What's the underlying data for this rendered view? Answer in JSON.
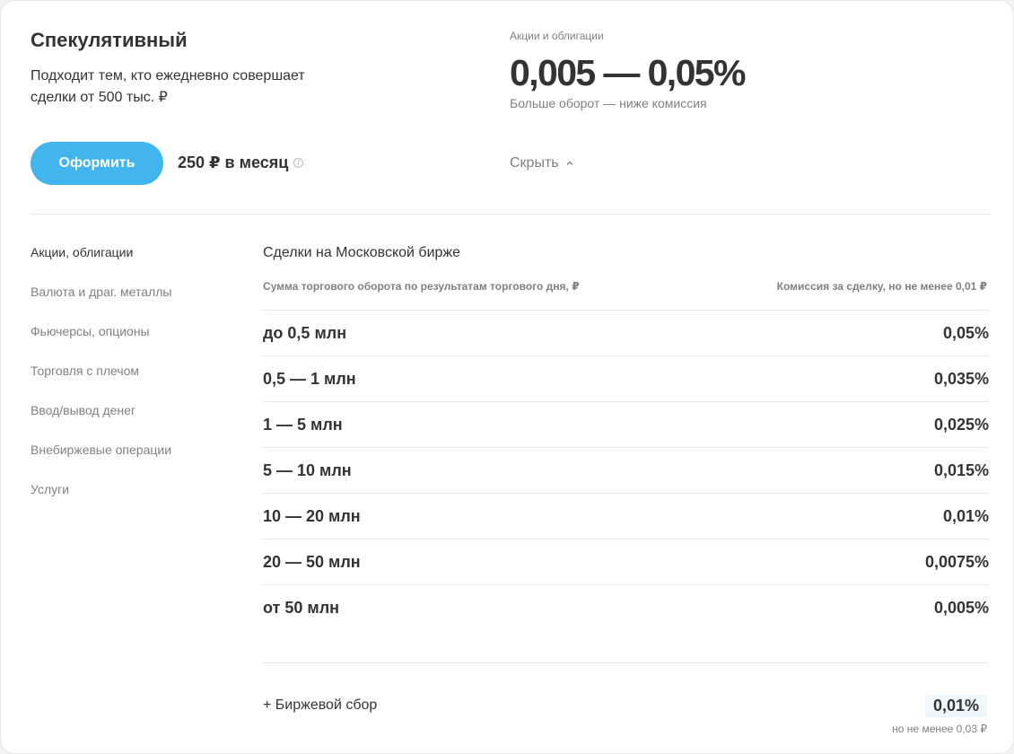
{
  "plan": {
    "title": "Спекулятивный",
    "description": "Подходит тем, кто ежедневно совершает сделки от 500 тыс. ₽",
    "apply_label": "Оформить",
    "price": "250 ₽ в месяц",
    "info_icon": "info-icon"
  },
  "rate_summary": {
    "label": "Акции и облигации",
    "value": "0,005 — 0,05%",
    "note": "Больше оборот — ниже комиссия",
    "toggle_label": "Скрыть",
    "toggle_icon": "chevron-up-icon"
  },
  "side_nav": {
    "items": [
      {
        "label": "Акции, облигации",
        "active": true
      },
      {
        "label": "Валюта и драг. металлы",
        "active": false
      },
      {
        "label": "Фьючерсы, опционы",
        "active": false
      },
      {
        "label": "Торговля с плечом",
        "active": false
      },
      {
        "label": "Ввод/вывод денег",
        "active": false
      },
      {
        "label": "Внебиржевые операции",
        "active": false
      },
      {
        "label": "Услуги",
        "active": false
      }
    ]
  },
  "table": {
    "title": "Сделки на Московской бирже",
    "col_left": "Сумма торгового оборота по результатам торгового дня, ₽",
    "col_right": "Комиссия за сделку, но не менее 0,01 ₽",
    "rows": [
      {
        "range": "до 0,5 млн",
        "fee": "0,05%"
      },
      {
        "range": "0,5 — 1 млн",
        "fee": "0,035%"
      },
      {
        "range": "1 — 5 млн",
        "fee": "0,025%"
      },
      {
        "range": "5 — 10 млн",
        "fee": "0,015%"
      },
      {
        "range": "10 — 20 млн",
        "fee": "0,01%"
      },
      {
        "range": "20 — 50 млн",
        "fee": "0,0075%"
      },
      {
        "range": "от 50 млн",
        "fee": "0,005%"
      }
    ]
  },
  "exchange_fee": {
    "label": "+ Биржевой сбор",
    "value": "0,01%",
    "min_note": "но не менее 0,03 ₽"
  },
  "colors": {
    "accent": "#41b5ec",
    "text": "#333333",
    "muted": "#808080",
    "highlight": "#eef7fc"
  }
}
